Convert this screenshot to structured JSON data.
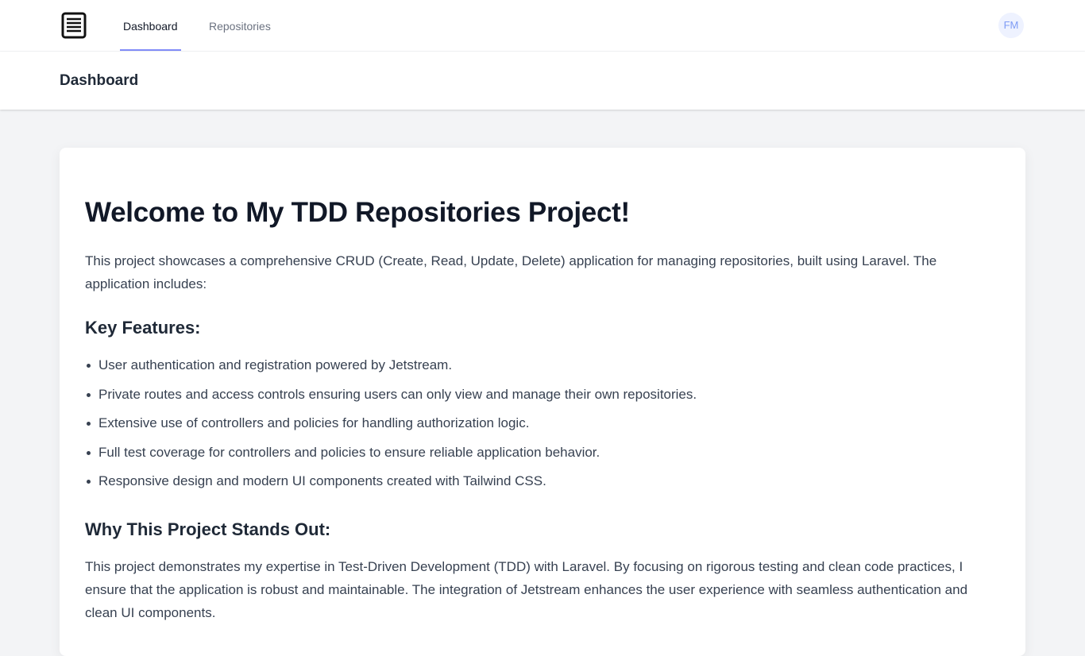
{
  "nav": {
    "links": [
      {
        "label": "Dashboard",
        "active": true
      },
      {
        "label": "Repositories",
        "active": false
      }
    ],
    "avatar_initials": "FM"
  },
  "header": {
    "title": "Dashboard"
  },
  "content": {
    "heading": "Welcome to My TDD Repositories Project!",
    "intro": "This project showcases a comprehensive CRUD (Create, Read, Update, Delete) application for managing repositories, built using Laravel. The application includes:",
    "features_heading": "Key Features:",
    "features": [
      "User authentication and registration powered by Jetstream.",
      "Private routes and access controls ensuring users can only view and manage their own repositories.",
      "Extensive use of controllers and policies for handling authorization logic.",
      "Full test coverage for controllers and policies to ensure reliable application behavior.",
      "Responsive design and modern UI components created with Tailwind CSS."
    ],
    "why_heading": "Why This Project Stands Out:",
    "why_text": "This project demonstrates my expertise in Test-Driven Development (TDD) with Laravel. By focusing on rigorous testing and clean code practices, I ensure that the application is robust and maintainable. The integration of Jetstream enhances the user experience with seamless authentication and clean UI components."
  },
  "colors": {
    "accent": "#818cf8",
    "avatar_bg": "#eef2ff",
    "avatar_text": "#7f9cf5",
    "page_bg": "#f3f4f6"
  }
}
